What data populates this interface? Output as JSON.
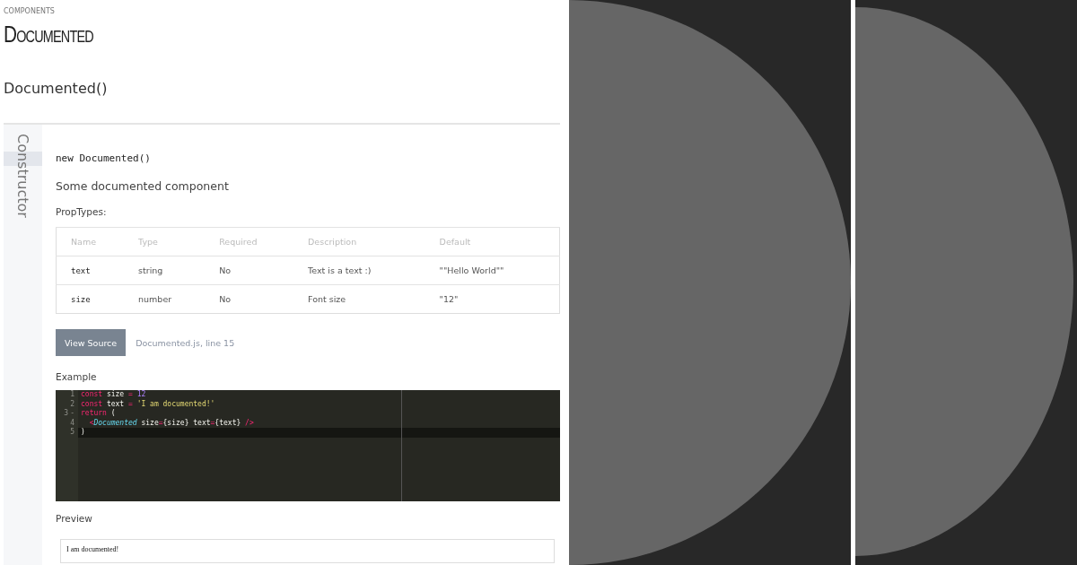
{
  "breadcrumb": "COMPONENTS",
  "title": "Documented",
  "signature": "Documented()",
  "side_tabs": [
    {
      "label": "Constructor",
      "selected": true
    }
  ],
  "constructor": {
    "code": "new Documented()",
    "description": "Some documented component",
    "proptypes_label": "PropTypes:"
  },
  "table": {
    "columns": [
      "Name",
      "Type",
      "Required",
      "Description",
      "Default"
    ],
    "rows": [
      [
        "text",
        "string",
        "No",
        "Text is a text :)",
        "\"\"Hello World\"\""
      ],
      [
        "size",
        "number",
        "No",
        "Font size",
        "\"12\""
      ]
    ]
  },
  "view_source": {
    "button": "View Source",
    "file": "Documented.js",
    "line": ", line 15"
  },
  "example": {
    "label": "Example",
    "lines": [
      {
        "number": "1",
        "active": false,
        "tokens": [
          {
            "kind": "keyword",
            "text": "const"
          },
          {
            "kind": "plain",
            "text": " size "
          },
          {
            "kind": "operator",
            "text": "="
          },
          {
            "kind": "number",
            "text": " 12"
          }
        ]
      },
      {
        "number": "2",
        "active": false,
        "tokens": [
          {
            "kind": "keyword",
            "text": "const"
          },
          {
            "kind": "plain",
            "text": " text "
          },
          {
            "kind": "operator",
            "text": "="
          },
          {
            "kind": "string",
            "text": " 'I am documented!'"
          }
        ]
      },
      {
        "number": "3",
        "fold": "-",
        "active": false,
        "tokens": [
          {
            "kind": "keyword",
            "text": "return"
          },
          {
            "kind": "plain",
            "text": " ("
          }
        ]
      },
      {
        "number": "4",
        "active": false,
        "tokens": [
          {
            "kind": "operator",
            "text": "  <"
          },
          {
            "kind": "tag",
            "text": "Documented"
          },
          {
            "kind": "plain",
            "text": " size"
          },
          {
            "kind": "operator",
            "text": "="
          },
          {
            "kind": "plain",
            "text": "{size} text"
          },
          {
            "kind": "operator",
            "text": "="
          },
          {
            "kind": "plain",
            "text": "{text} "
          },
          {
            "kind": "operator",
            "text": "/>"
          }
        ]
      },
      {
        "number": "5",
        "active": true,
        "tokens": [
          {
            "kind": "plain",
            "text": ")"
          }
        ]
      }
    ]
  },
  "preview": {
    "label": "Preview",
    "output": "I am documented!"
  }
}
